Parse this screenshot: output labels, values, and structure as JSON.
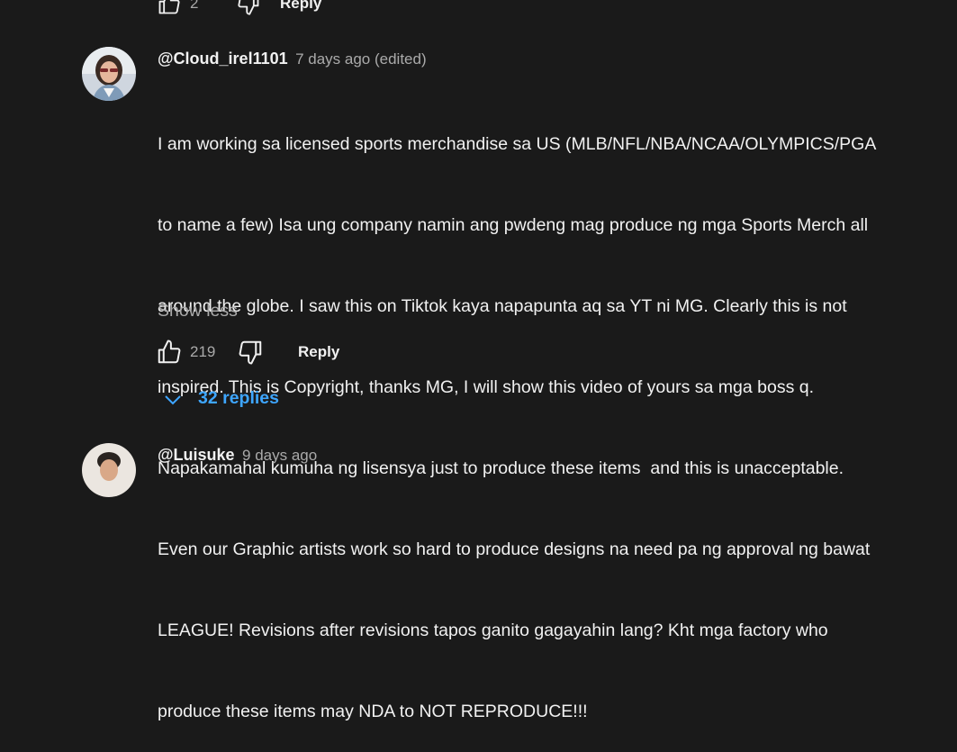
{
  "prev_comment": {
    "like_count": "2",
    "reply_label": "Reply"
  },
  "comment": {
    "author": "@Cloud_irel1101",
    "timestamp": "7 days ago (edited)",
    "lines": [
      "I am working sa licensed sports merchandise sa US (MLB/NFL/NBA/NCAA/OLYMPICS/PGA",
      "to name a few) Isa ung company namin ang pwdeng mag produce ng mga Sports Merch all",
      "around the globe. I saw this on Tiktok kaya napapunta aq sa YT ni MG. Clearly this is not",
      "inspired. This is Copyright, thanks MG, I will show this video of yours sa mga boss q.",
      "Napakamahal kumuha ng lisensya just to produce these items  and this is unacceptable.",
      "Even our Graphic artists work so hard to produce designs na need pa ng approval ng bawat",
      "LEAGUE! Revisions after revisions tapos ganito gagayahin lang? Kht mga factory who",
      "produce these items may NDA to NOT REPRODUCE!!!"
    ],
    "show_less_label": "Show less",
    "like_count": "219",
    "reply_label": "Reply",
    "replies_label": "32 replies"
  },
  "next_comment": {
    "author": "@Luisuke",
    "timestamp": "9 days ago"
  },
  "colors": {
    "background": "#1a1a1a",
    "link_blue": "#3ea6ff",
    "muted_text": "#aaaaaa"
  },
  "icons": [
    "thumbs-up-icon",
    "thumbs-down-icon",
    "chevron-down-icon"
  ]
}
